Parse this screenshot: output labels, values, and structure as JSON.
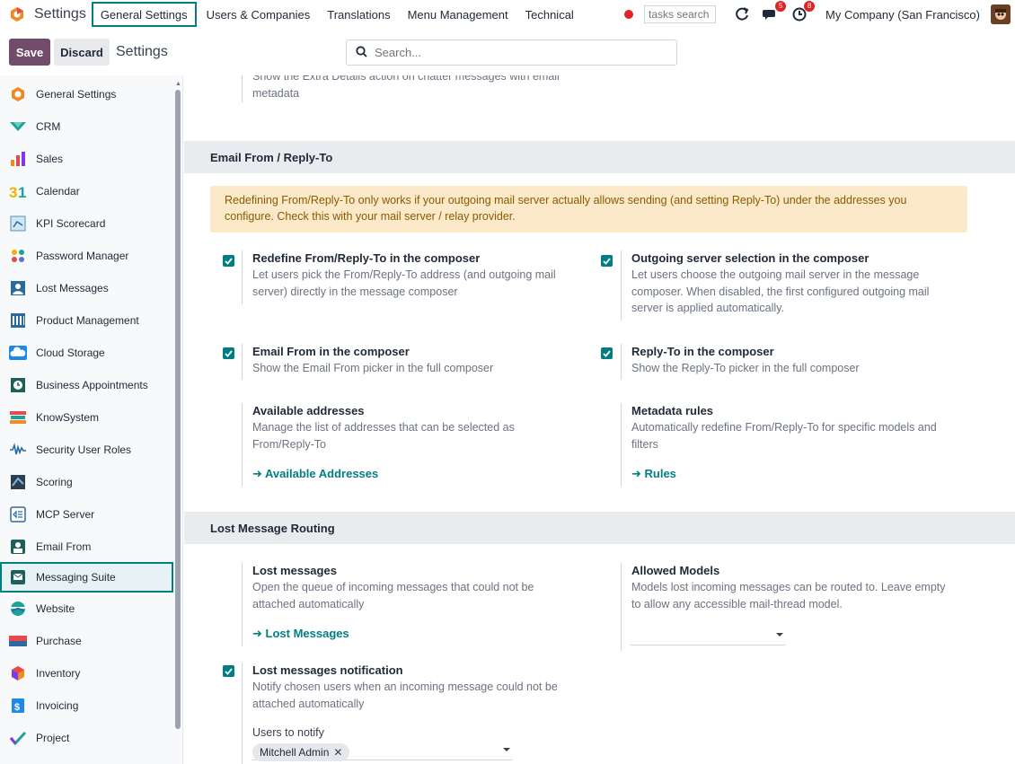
{
  "navbar": {
    "app_name": "Settings",
    "menu": [
      "General Settings",
      "Users & Companies",
      "Translations",
      "Menu Management",
      "Technical"
    ],
    "tasks_search_placeholder": "tasks search",
    "chat_badge": "5",
    "activity_badge": "8",
    "company": "My Company (San Francisco)"
  },
  "control": {
    "save_label": "Save",
    "discard_label": "Discard",
    "title": "Settings",
    "search_placeholder": "Search..."
  },
  "sidebar": {
    "items": [
      {
        "label": "General Settings",
        "icon": "settings-app-icon"
      },
      {
        "label": "CRM",
        "icon": "crm-icon"
      },
      {
        "label": "Sales",
        "icon": "sales-icon"
      },
      {
        "label": "Calendar",
        "icon": "calendar-icon"
      },
      {
        "label": "KPI Scorecard",
        "icon": "kpi-icon"
      },
      {
        "label": "Password Manager",
        "icon": "password-icon"
      },
      {
        "label": "Lost Messages",
        "icon": "lost-messages-icon"
      },
      {
        "label": "Product Management",
        "icon": "product-icon"
      },
      {
        "label": "Cloud Storage",
        "icon": "cloud-icon"
      },
      {
        "label": "Business Appointments",
        "icon": "appointments-icon"
      },
      {
        "label": "KnowSystem",
        "icon": "books-icon"
      },
      {
        "label": "Security User Roles",
        "icon": "roles-icon"
      },
      {
        "label": "Scoring",
        "icon": "scoring-icon"
      },
      {
        "label": "MCP Server",
        "icon": "mcp-icon"
      },
      {
        "label": "Email From",
        "icon": "email-from-icon"
      },
      {
        "label": "Messaging Suite",
        "icon": "messaging-icon"
      },
      {
        "label": "Website",
        "icon": "website-icon"
      },
      {
        "label": "Purchase",
        "icon": "purchase-icon"
      },
      {
        "label": "Inventory",
        "icon": "inventory-icon"
      },
      {
        "label": "Invoicing",
        "icon": "invoicing-icon"
      },
      {
        "label": "Project",
        "icon": "project-icon"
      }
    ],
    "active_index": 15
  },
  "main": {
    "top_partial": {
      "line1": "Show the Extra Details action on chatter messages with email",
      "line2": "metadata"
    },
    "section_email": {
      "heading": "Email From / Reply-To",
      "alert": "Redefining From/Reply-To only works if your outgoing mail server actually allows sending (and setting Reply-To) under the addresses you configure. Check this with your mail server / relay provider.",
      "redefine": {
        "title": "Redefine From/Reply-To in the composer",
        "desc": "Let users pick the From/Reply-To address (and outgoing mail server) directly in the message composer",
        "checked": true
      },
      "outgoing": {
        "title": "Outgoing server selection in the composer",
        "desc": "Let users choose the outgoing mail server in the message composer. When disabled, the first configured outgoing mail server is applied automatically.",
        "checked": true
      },
      "email_from": {
        "title": "Email From in the composer",
        "desc": "Show the Email From picker in the full composer",
        "checked": true
      },
      "reply_to": {
        "title": "Reply-To in the composer",
        "desc": "Show the Reply-To picker in the full composer",
        "checked": true
      },
      "available": {
        "title": "Available addresses",
        "desc": "Manage the list of addresses that can be selected as From/Reply-To",
        "link": "Available Addresses"
      },
      "metadata": {
        "title": "Metadata rules",
        "desc": "Automatically redefine From/Reply-To for specific models and filters",
        "link": "Rules"
      }
    },
    "section_lost": {
      "heading": "Lost Message Routing",
      "lost_messages": {
        "title": "Lost messages",
        "desc": "Open the queue of incoming messages that could not be attached automatically",
        "link": "Lost Messages"
      },
      "allowed_models": {
        "title": "Allowed Models",
        "desc": "Models lost incoming messages can be routed to. Leave empty to allow any accessible mail-thread model."
      },
      "notification": {
        "title": "Lost messages notification",
        "desc": "Notify chosen users when an incoming message could not be attached automatically",
        "checked": true
      },
      "users_to_notify": {
        "label": "Users to notify",
        "tag": "Mitchell Admin"
      }
    }
  },
  "colors": {
    "brand": "#714b67",
    "accent": "#017e84",
    "alert_bg": "#fbe9c9"
  }
}
